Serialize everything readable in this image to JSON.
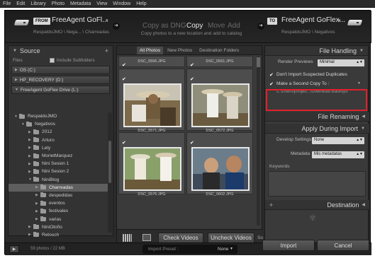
{
  "menu": [
    "File",
    "Edit",
    "Library",
    "Photo",
    "Metadata",
    "View",
    "Window",
    "Help"
  ],
  "header": {
    "from_tag": "FROM",
    "from_drive": "FreeAgent GoFl...",
    "from_path": "RespaldoJMO \\ Nega... \\ Charreadas",
    "modes": [
      "Copy as DNG",
      "Copy",
      "Move",
      "Add"
    ],
    "active_mode": "Copy",
    "mode_desc": "Copy photos to a new location and add to catalog",
    "to_tag": "TO",
    "to_drive": "FreeAgent GoFlex...",
    "to_path": "RespaldoJMO \\ Negativos"
  },
  "source": {
    "title": "Source",
    "plus": "+",
    "files_label": "Files",
    "include_subfolders": "Include Subfolders",
    "drives": [
      "OS (C:)",
      "HP_RECOVERY (D:)",
      "FreeAgent GoFlex Drive (L:)"
    ],
    "tree": [
      {
        "label": "RespaldoJMO",
        "level": 0,
        "expanded": true
      },
      {
        "label": "Negativos",
        "level": 1,
        "expanded": true
      },
      {
        "label": "2012",
        "level": 2,
        "expanded": false
      },
      {
        "label": "Arturo",
        "level": 2,
        "expanded": false
      },
      {
        "label": "Lety",
        "level": 2,
        "expanded": false
      },
      {
        "label": "MorietMarquez",
        "level": 2,
        "expanded": false
      },
      {
        "label": "Nini Sesion 1",
        "level": 2,
        "expanded": false
      },
      {
        "label": "Nini Sesion 2",
        "level": 2,
        "expanded": false
      },
      {
        "label": "NiniBlog",
        "level": 2,
        "expanded": true
      },
      {
        "label": "Charreadas",
        "level": 3,
        "expanded": false,
        "selected": true
      },
      {
        "label": "despedidas",
        "level": 3,
        "expanded": false
      },
      {
        "label": "eventos",
        "level": 3,
        "expanded": false
      },
      {
        "label": "festivales",
        "level": 3,
        "expanded": false
      },
      {
        "label": "varias",
        "level": 3,
        "expanded": false
      },
      {
        "label": "NiniOtoño",
        "level": 2,
        "expanded": false
      },
      {
        "label": "Retouch",
        "level": 2,
        "expanded": false
      },
      {
        "label": "Sisal",
        "level": 2,
        "expanded": false
      },
      {
        "label": "Tejidos",
        "level": 2,
        "expanded": false
      }
    ]
  },
  "grid": {
    "tabs": [
      "All Photos",
      "New Photos",
      "Destination Folders"
    ],
    "active_tab": "All Photos",
    "top_files": [
      "DSC_0556.JPG",
      "DSC_0561.JPG"
    ],
    "photos": [
      {
        "file": "DSC_0571.JPG",
        "checked": true
      },
      {
        "file": "DSC_0572.JPG",
        "checked": true
      },
      {
        "file": "DSC_0576.JPG",
        "checked": true
      },
      {
        "file": "DSC_0602.JPG",
        "checked": true
      }
    ],
    "check_videos": "Check Videos",
    "uncheck_videos": "Uncheck Videos",
    "sort_label": "So"
  },
  "right": {
    "file_handling": "File Handling",
    "render_previews_label": "Render Previews",
    "render_previews_value": "Minimal",
    "dont_import_dupes": "Don't Import Suspected Duplicates",
    "second_copy": "Make a Second Copy To :",
    "second_copy_path": "C:\\Users\\jmojed...\\Download Backups",
    "file_renaming": "File Renaming",
    "apply_during_import": "Apply During Import",
    "develop_settings_label": "Develop Settings",
    "develop_settings_value": "None",
    "metadata_label": "Metadata",
    "metadata_value": "Mis metadatas",
    "keywords_label": "Keywords",
    "destination": "Destination",
    "plus": "+"
  },
  "bottom": {
    "count": "59 photos / 22 MB",
    "preset_label": "Import Preset :",
    "preset_value": "None",
    "import": "Import",
    "cancel": "Cancel"
  },
  "colors": {
    "highlight_box": "#e0202a",
    "panel_bg": "#3a3a3a",
    "window_bg": "#2a2a2a"
  }
}
